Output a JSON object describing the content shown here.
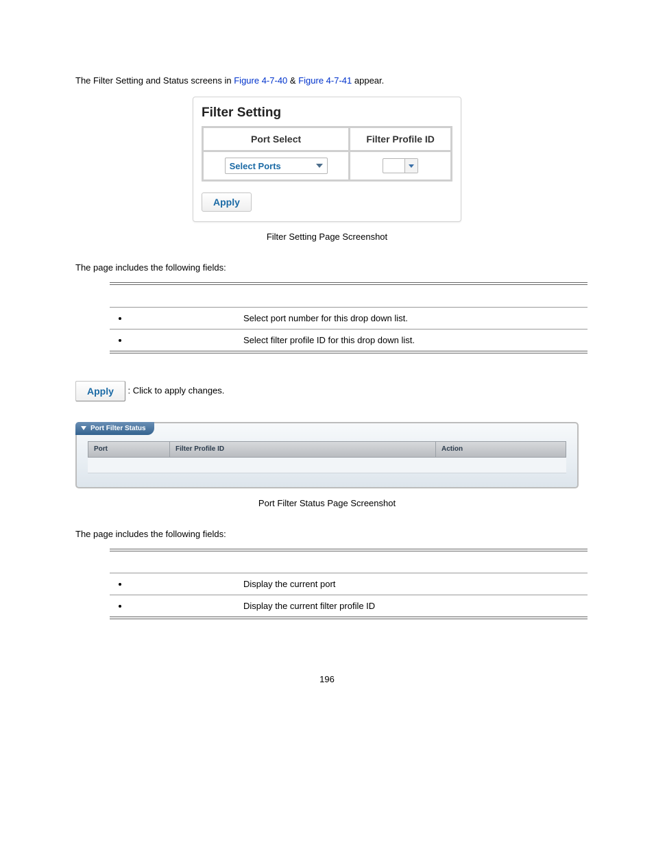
{
  "intro": {
    "prefix": "The Filter Setting and Status screens in ",
    "link1": "Figure 4-7-40",
    "amp": " & ",
    "link2": "Figure 4-7-41",
    "suffix": " appear."
  },
  "filter_widget": {
    "title": "Filter Setting",
    "headers": {
      "port_select": "Port Select",
      "filter_profile_id": "Filter Profile ID"
    },
    "port_select_label": "Select Ports",
    "apply_label": "Apply"
  },
  "captions": {
    "filter": "Filter Setting Page Screenshot",
    "status": "Port Filter Status Page Screenshot"
  },
  "section_label": "The page includes the following fields:",
  "table1": {
    "rows": [
      {
        "desc": "Select port number for this drop down list."
      },
      {
        "desc": "Select filter profile ID for this drop down list."
      }
    ]
  },
  "apply_line": {
    "chip": "Apply",
    "text": ": Click to apply changes."
  },
  "status_widget": {
    "tab": "Port Filter Status",
    "headers": {
      "port": "Port",
      "filter_profile_id": "Filter Profile ID",
      "action": "Action"
    }
  },
  "table2": {
    "rows": [
      {
        "desc": "Display the current port"
      },
      {
        "desc": "Display the current filter profile ID"
      }
    ]
  },
  "page_number": "196"
}
